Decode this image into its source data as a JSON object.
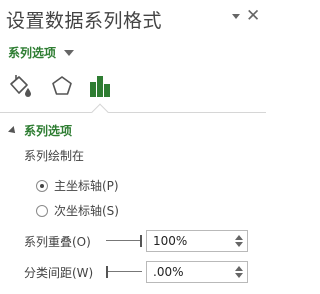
{
  "pane": {
    "title": "设置数据系列格式",
    "close_glyph": "✕",
    "options_dropdown_label": "系列选项"
  },
  "tabs": [
    {
      "name": "fill-line",
      "icon": "paint-bucket-icon"
    },
    {
      "name": "effects",
      "icon": "pentagon-icon"
    },
    {
      "name": "series-options",
      "icon": "bar-chart-icon",
      "active": true
    }
  ],
  "section": {
    "header": "系列选项",
    "plot_on_label": "系列绘制在",
    "primary_axis_label": "主坐标轴(P)",
    "secondary_axis_label": "次坐标轴(S)",
    "selected_axis": "primary",
    "series_overlap_label": "系列重叠(O)",
    "series_overlap_value": "100%",
    "series_overlap_level": 1.0,
    "gap_width_label": "分类间距(W)",
    "gap_width_value": ".00%",
    "gap_width_level": 0.0
  },
  "colors": {
    "accent_green": "#2e7d32",
    "text": "#444444",
    "divider": "#d6d6d6"
  }
}
